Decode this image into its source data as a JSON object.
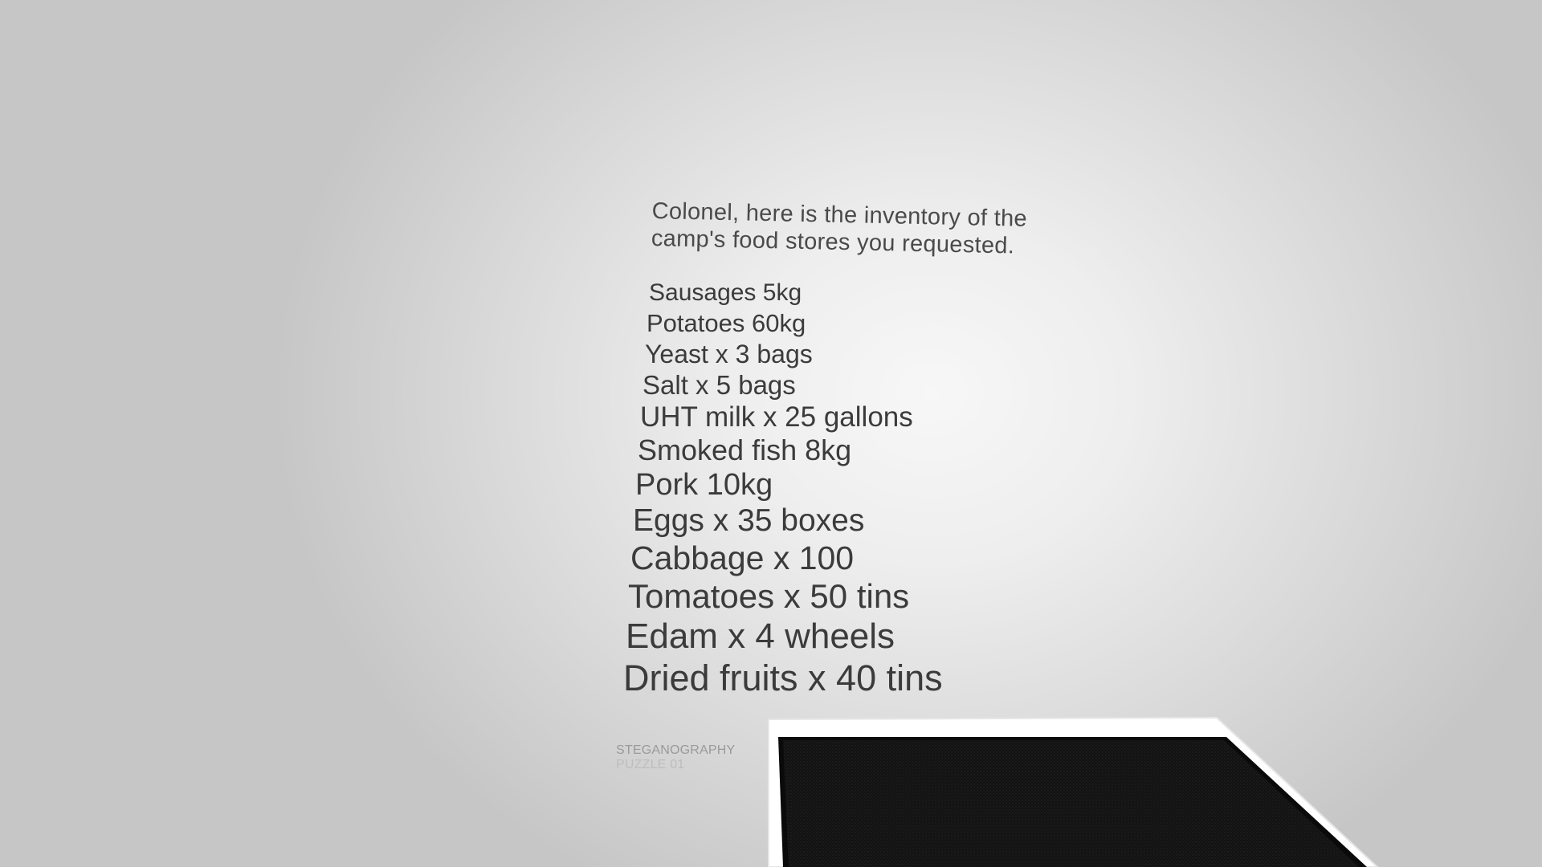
{
  "note": {
    "line1": "Colonel, here is the inventory of the",
    "line2": "camp's food stores you requested."
  },
  "inventory": [
    "Sausages 5kg",
    "Potatoes 60kg",
    "Yeast x 3 bags",
    "Salt x 5 bags",
    "UHT milk x 25 gallons",
    "Smoked fish 8kg",
    "Pork 10kg",
    "Eggs x 35 boxes",
    "Cabbage x 100",
    "Tomatoes x 50 tins",
    "Edam x 4 wheels",
    "Dried fruits x 40 tins"
  ],
  "puzzle_label": {
    "line1": "STEGANOGRAPHY",
    "line2": "PUZZLE 01"
  },
  "colors": {
    "background_center": "#f7f7f7",
    "background_edge": "#c6c6c6",
    "text": "#3b3b3b",
    "device_frame": "#ffffff",
    "device_screen": "#111111"
  }
}
